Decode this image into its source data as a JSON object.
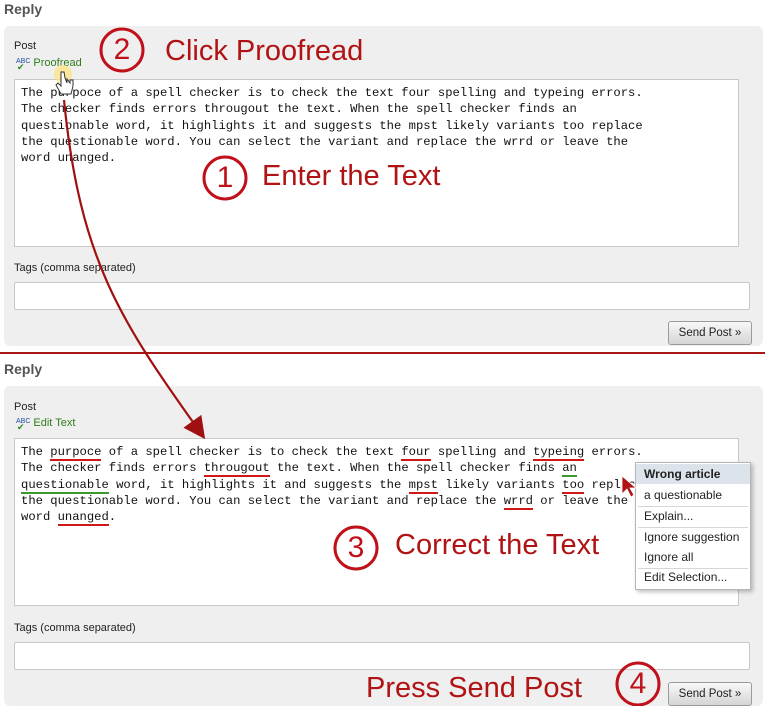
{
  "top": {
    "heading": "Reply",
    "post_label": "Post",
    "proofread_link": "Proofread",
    "editor_lines": [
      "The purpoce of a spell checker is to check the text four spelling and typeing errors.",
      "The checker finds errors througout the text. When the spell checker finds an",
      "questionable word, it highlights it and suggests the mpst likely variants too replace",
      "the questionable word. You can select the variant and replace the wrrd or leave the",
      "word unanged."
    ],
    "tags_label": "Tags (comma separated)",
    "tags_value": "",
    "send_button": "Send Post »"
  },
  "bottom": {
    "heading": "Reply",
    "post_label": "Post",
    "edit_link": "Edit Text",
    "tags_label": "Tags (comma separated)",
    "tags_value": "",
    "send_button": "Send Post »"
  },
  "context_menu": {
    "header": "Wrong article",
    "suggestion": "a questionable",
    "explain": "Explain...",
    "ignore_suggestion": "Ignore suggestion",
    "ignore_all": "Ignore all",
    "edit_selection": "Edit Selection..."
  },
  "steps": [
    {
      "number": "1",
      "label": "Enter the Text"
    },
    {
      "number": "2",
      "label": "Click Proofread"
    },
    {
      "number": "3",
      "label": "Correct the Text"
    },
    {
      "number": "4",
      "label": "Press Send Post"
    }
  ],
  "colors": {
    "annotation_red": "#b01313",
    "error_underline": "#d01818",
    "grammar_underline": "#3c9a2c",
    "panel_bg": "#efefef"
  },
  "icons": {
    "spellcheck": "abc-check-icon",
    "cursor": "hand-cursor-icon"
  }
}
